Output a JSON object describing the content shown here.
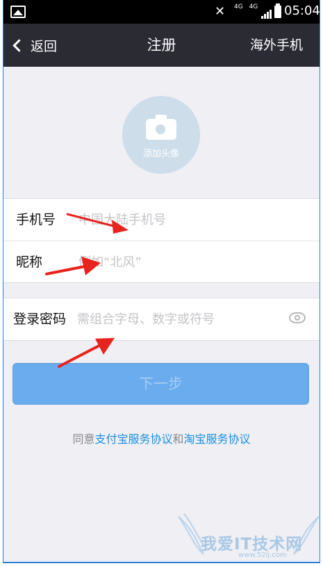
{
  "status_bar": {
    "time": "05:04",
    "network_1": "4G",
    "network_2": "4G",
    "signal_1": "4G",
    "signal_2": "G"
  },
  "nav": {
    "back_label": "返回",
    "title": "注册",
    "right_label": "海外手机"
  },
  "avatar": {
    "label": "添加头像"
  },
  "form": {
    "phone": {
      "label": "手机号",
      "placeholder": "中国大陆手机号",
      "value": ""
    },
    "nickname": {
      "label": "昵称",
      "placeholder": "例如“北风”",
      "value": ""
    },
    "password": {
      "label": "登录密码",
      "placeholder": "需组合字母、数字或符号",
      "value": ""
    }
  },
  "next_button": {
    "label": "下一步"
  },
  "agreement": {
    "prefix": "同意",
    "link_1": "支付宝服务协议",
    "joiner": "和",
    "link_2": "淘宝服务协议"
  },
  "watermark": {
    "text": "我爱IT技术网",
    "sub": "www.52ij.com"
  },
  "colors": {
    "navbar": "#2b2b34",
    "background": "#efeff4",
    "button": "#6aacee",
    "link": "#1a8fe0",
    "annotation_arrow": "#e8231e"
  },
  "icons": [
    "image-icon",
    "mute-icon",
    "signal-icon",
    "battery-icon",
    "chevron-left-icon",
    "camera-icon",
    "eye-icon"
  ]
}
